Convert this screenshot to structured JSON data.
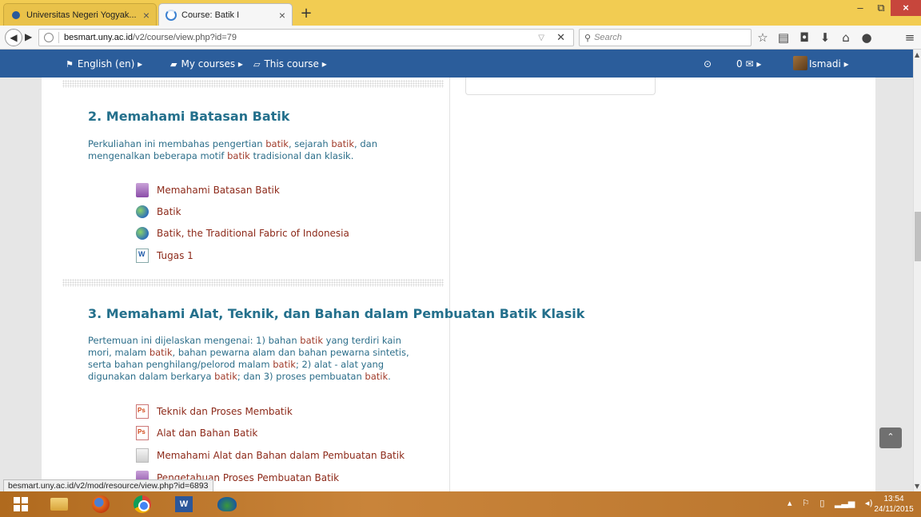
{
  "browser": {
    "tabs": [
      {
        "title": "Universitas Negeri Yogyak...",
        "close": "×"
      },
      {
        "title": "Course: Batik I",
        "close": "×"
      }
    ],
    "new_tab": "+",
    "window_controls": {
      "minimize": "–",
      "maximize": "⧉",
      "close": "×"
    },
    "url_host": "besmart.uny.ac.id",
    "url_path": "/v2/course/view.php?id=79",
    "search_placeholder": "Search",
    "search_glyph": "⚲"
  },
  "moodle_nav": {
    "language": "English (en) ▸",
    "my_courses": "My courses ▸",
    "this_course": "This course ▸",
    "notifications": "⊙",
    "messages": "0 ✉ ▸",
    "user": "Ismadi ▸"
  },
  "sections": [
    {
      "title": "2. Memahami Batasan Batik",
      "summary_parts": [
        "Perkuliahan ini membahas pengertian ",
        "batik",
        ", sejarah ",
        "batik",
        ", dan mengenalkan beberapa motif ",
        "batik",
        " tradisional dan klasik."
      ],
      "activities": [
        {
          "label": "Memahami Batasan Batik",
          "icon": "book-icon"
        },
        {
          "label": "Batik",
          "icon": "url-globe-icon"
        },
        {
          "label": "Batik, the Traditional Fabric of Indonesia",
          "icon": "url-globe-icon"
        },
        {
          "label": "Tugas 1",
          "icon": "word-document-icon"
        }
      ]
    },
    {
      "title": "3. Memahami Alat, Teknik, dan Bahan dalam Pembuatan Batik Klasik",
      "summary_parts": [
        "Pertemuan ini dijelaskan mengenai: 1) bahan ",
        "batik",
        " yang terdiri kain mori, malam ",
        "batik",
        ", bahan pewarna alam dan bahan pewarna sintetis, serta bahan penghilang/pelorod malam ",
        "batik",
        "; 2) alat - alat yang digunakan dalam berkarya ",
        "batik",
        "; dan 3) proses pembuatan ",
        "batik",
        "."
      ],
      "activities": [
        {
          "label": "Teknik dan Proses Membatik",
          "icon": "powerpoint-icon"
        },
        {
          "label": "Alat dan Bahan Batik",
          "icon": "powerpoint-icon"
        },
        {
          "label": "Memahami Alat dan Bahan dalam Pembuatan Batik",
          "icon": "file-icon"
        },
        {
          "label": "Pengetahuan Proses Pembuatan Batik",
          "icon": "book-icon"
        }
      ]
    }
  ],
  "status_url": "besmart.uny.ac.id/v2/mod/resource/view.php?id=6893",
  "back_to_top": "⌃",
  "taskbar": {
    "apps": [
      "start-button",
      "file-explorer-icon",
      "firefox-icon",
      "chrome-icon",
      "word-icon",
      "app-icon"
    ],
    "word_letter": "W",
    "clock_time": "13:54",
    "clock_date": "24/11/2015"
  },
  "colors": {
    "moodle_bar": "#2b5d9b",
    "section_title": "#24708c",
    "activity_link": "#8d2a1a",
    "taskbar": "#b8742c",
    "firefox_tabbar": "#f2cc52"
  }
}
